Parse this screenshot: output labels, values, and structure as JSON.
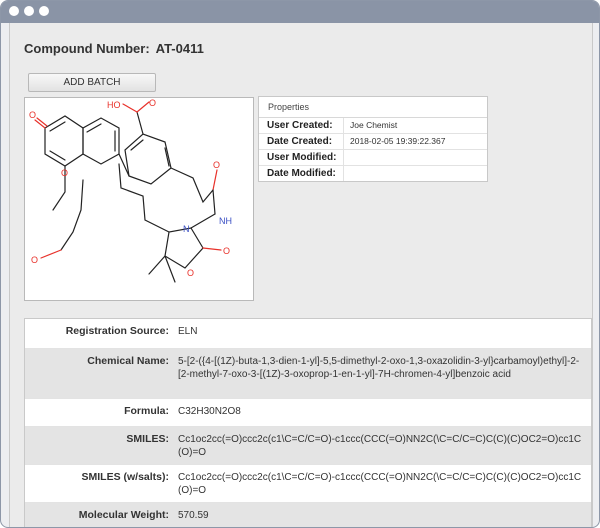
{
  "compound": {
    "label": "Compound Number:",
    "number": "AT-0411"
  },
  "actions": {
    "add_batch": "ADD BATCH"
  },
  "structure_atoms": {
    "o_ketone": "O",
    "o_ring": "O",
    "o_aldehyde": "O",
    "ho": "HO",
    "o_acid": "O",
    "o_amide": "O",
    "nh": "NH",
    "n": "N",
    "o_ox_carbonyl": "O",
    "o_ox_ring": "O"
  },
  "properties": {
    "header": "Properties",
    "rows": [
      {
        "label": "User Created:",
        "value": "Joe Chemist"
      },
      {
        "label": "Date Created:",
        "value": "2018-02-05 19:39:22.367"
      },
      {
        "label": "User Modified:",
        "value": ""
      },
      {
        "label": "Date Modified:",
        "value": ""
      }
    ]
  },
  "details": [
    {
      "label": "Registration Source:",
      "value": "ELN"
    },
    {
      "label": "Chemical Name:",
      "value": "5-[2-({4-[(1Z)-buta-1,3-dien-1-yl]-5,5-dimethyl-2-oxo-1,3-oxazolidin-3-yl}carbamoyl)ethyl]-2-[2-methyl-7-oxo-3-[(1Z)-3-oxoprop-1-en-1-yl]-7H-chromen-4-yl]benzoic acid"
    },
    {
      "label": "Formula:",
      "value": "C32H30N2O8"
    },
    {
      "label": "SMILES:",
      "value": "Cc1oc2cc(=O)ccc2c(c1\\C=C/C=O)-c1ccc(CCC(=O)NN2C(\\C=C/C=C)C(C)(C)OC2=O)cc1C(O)=O"
    },
    {
      "label": "SMILES (w/salts):",
      "value": "Cc1oc2cc(=O)ccc2c(c1\\C=C/C=O)-c1ccc(CCC(=O)NN2C(\\C=C/C=C)C(C)(C)OC2=O)cc1C(O)=O"
    },
    {
      "label": "Molecular Weight:",
      "value": "570.59"
    }
  ],
  "colors": {
    "titlebar": "#8a94a6",
    "panel": "#ebebeb",
    "oxygen": "#e8312a",
    "nitrogen": "#3a4fc4",
    "bond": "#222222"
  }
}
